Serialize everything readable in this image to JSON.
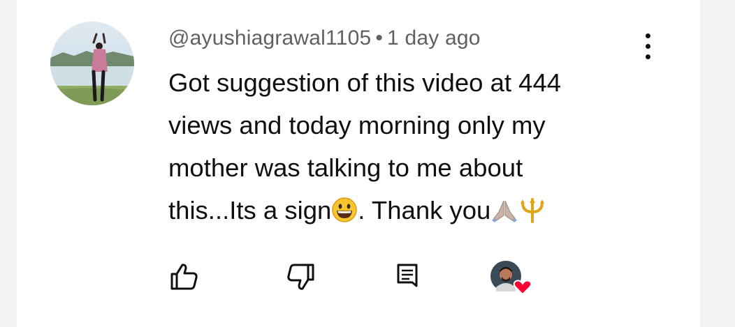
{
  "comment": {
    "author": "@ayushiagrawal1105",
    "separator": "•",
    "time": "1 day ago",
    "text_line_1": "Got suggestion of this video at 444",
    "text_line_2": "views and today morning only my",
    "text_line_3": "mother was talking to me about",
    "text_line_4a": "this...Its a sign",
    "text_line_4b": ". Thank you"
  },
  "icons": {
    "avatar": "user-avatar",
    "more": "vertical-ellipsis-icon",
    "like": "thumbs-up-icon",
    "dislike": "thumbs-down-icon",
    "reply": "comment-reply-icon",
    "creator_heart": "creator-heart-avatar",
    "emoji_smile": "grinning-face-emoji",
    "emoji_pray": "folded-hands-emoji",
    "emoji_trident": "trident-emoji"
  },
  "colors": {
    "text": "#0f0f0f",
    "meta": "#606060",
    "heart": "#ff0033",
    "background": "#ffffff"
  }
}
